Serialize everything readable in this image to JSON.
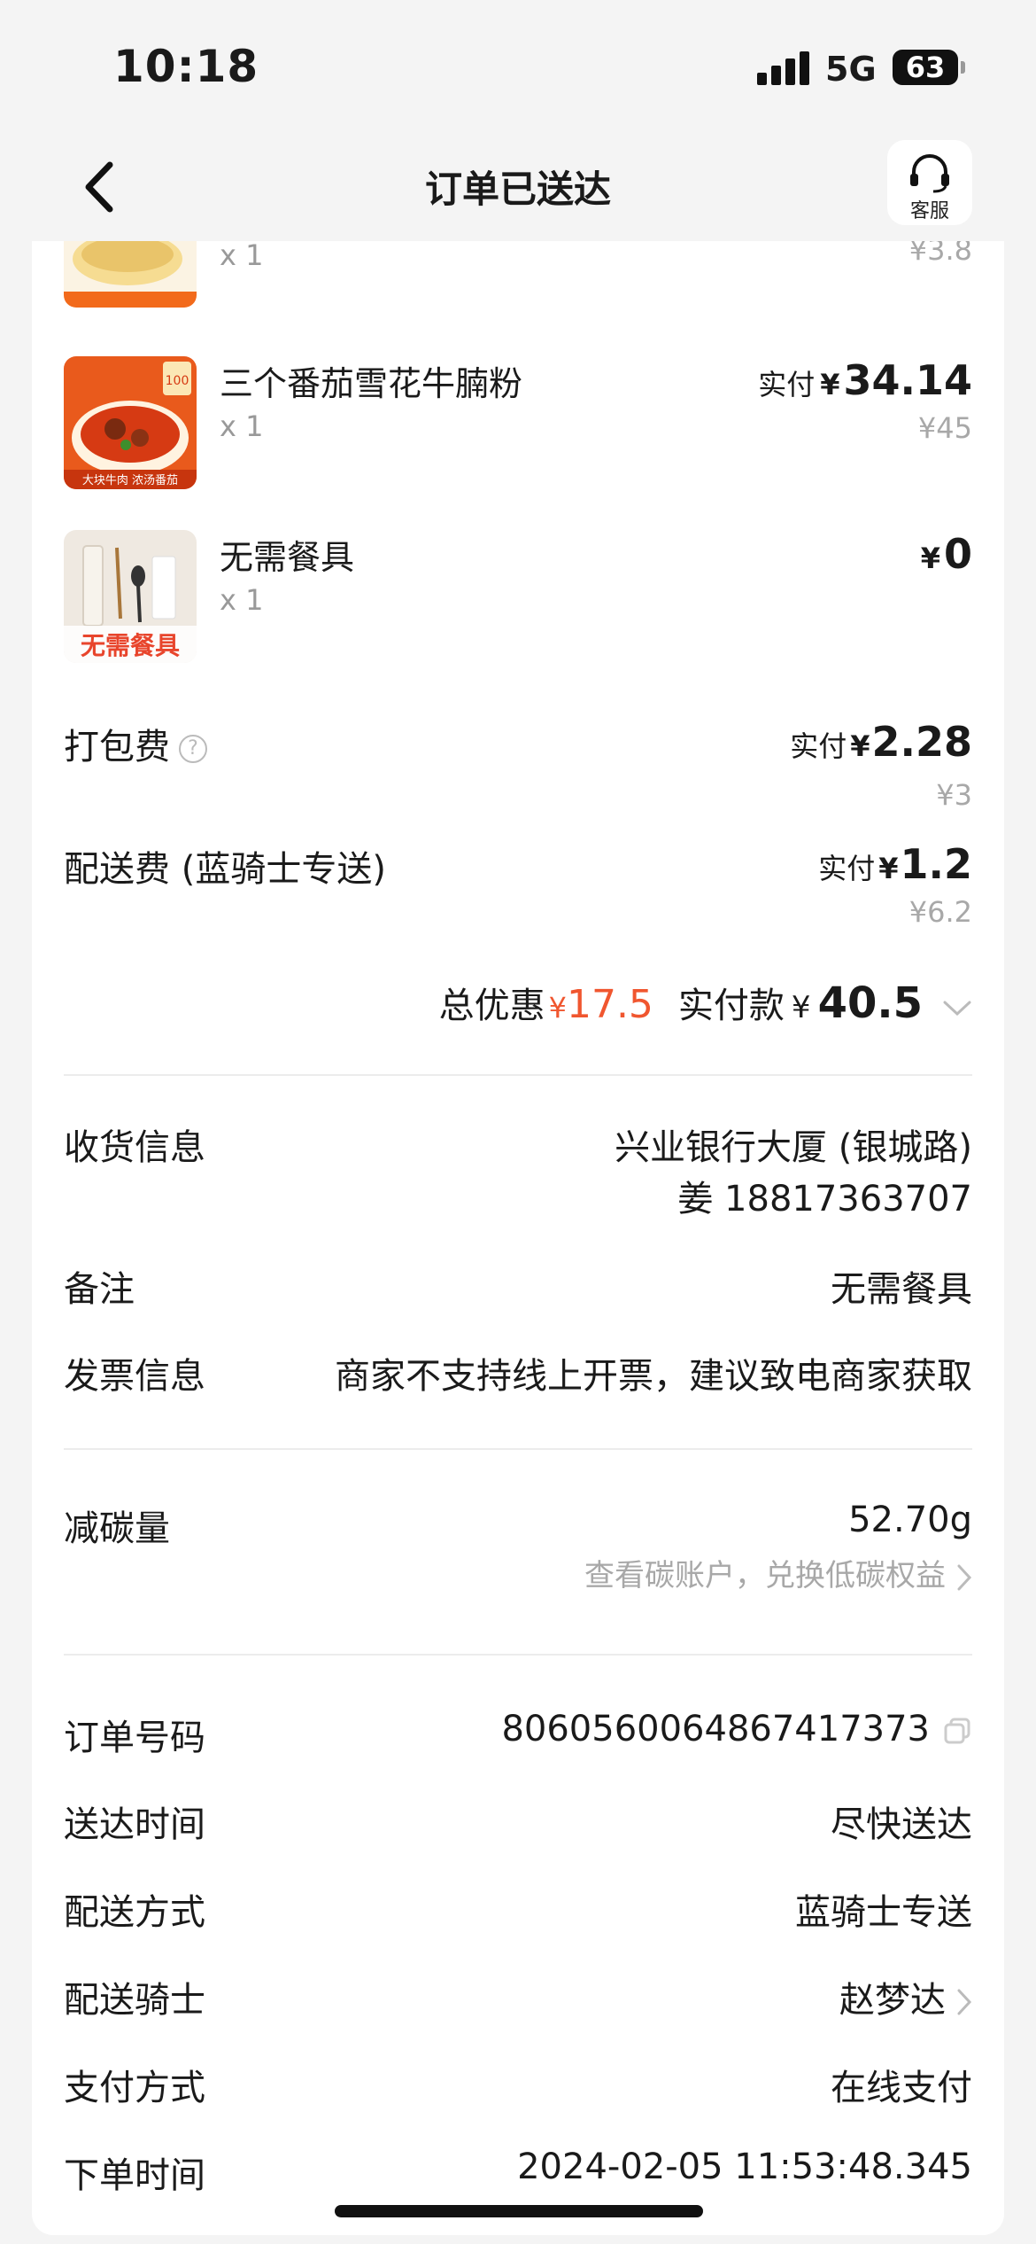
{
  "status_bar": {
    "time": "10:18",
    "network": "5G",
    "battery": "63"
  },
  "nav": {
    "title": "订单已送达",
    "customer_service_label": "客服"
  },
  "items": [
    {
      "name": "",
      "qty": "x 1",
      "paid_label": "",
      "currency": "",
      "price": "",
      "original": "¥3.8"
    },
    {
      "name": "三个番茄雪花牛腩粉",
      "qty": "x 1",
      "paid_label": "实付",
      "currency": "¥",
      "price": "34.14",
      "original": "¥45",
      "thumb_text_badge": "100",
      "thumb_text_bottom": "大块牛肉 浓汤番茄"
    },
    {
      "name": "无需餐具",
      "qty": "x 1",
      "paid_label": "",
      "currency": "¥",
      "price": "0",
      "original": "",
      "thumb_text": "无需餐具"
    }
  ],
  "fees": {
    "packing": {
      "label": "打包费",
      "paid_label": "实付",
      "currency": "¥",
      "price": "2.28",
      "original": "¥3"
    },
    "delivery": {
      "label": "配送费 (蓝骑士专送)",
      "paid_label": "实付",
      "currency": "¥",
      "price": "1.2",
      "original": "¥6.2"
    }
  },
  "summary": {
    "discount_label": "总优惠",
    "discount_currency": "¥",
    "discount_value": "17.5",
    "paid_label": "实付款",
    "paid_currency": "¥",
    "paid_value": "40.5"
  },
  "delivery_info": {
    "receiver_label": "收货信息",
    "address": "兴业银行大厦 (银城路)",
    "contact": "姜 18817363707",
    "note_label": "备注",
    "note_value": "无需餐具",
    "invoice_label": "发票信息",
    "invoice_value": "商家不支持线上开票，建议致电商家获取"
  },
  "carbon": {
    "label": "减碳量",
    "value": "52.70g",
    "link": "查看碳账户，兑换低碳权益"
  },
  "order": {
    "number_label": "订单号码",
    "number_value": "8060560064867417373",
    "arrival_label": "送达时间",
    "arrival_value": "尽快送达",
    "method_label": "配送方式",
    "method_value": "蓝骑士专送",
    "rider_label": "配送骑士",
    "rider_value": "赵梦达",
    "payment_label": "支付方式",
    "payment_value": "在线支付",
    "time_label": "下单时间",
    "time_value": "2024-02-05 11:53:48.345"
  },
  "colors": {
    "accent_red": "#f0562f",
    "muted": "#a8a8a8",
    "brand_orange": "#f26a1b"
  }
}
